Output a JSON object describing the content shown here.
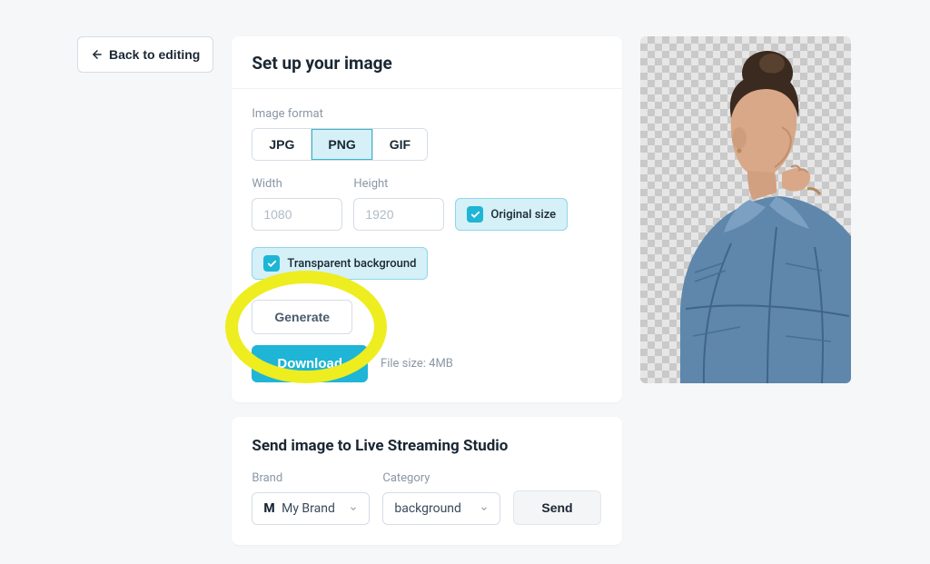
{
  "back_label": "Back to editing",
  "setup": {
    "title": "Set up your image",
    "format_label": "Image format",
    "formats": [
      "JPG",
      "PNG",
      "GIF"
    ],
    "selected_format": "PNG",
    "width_label": "Width",
    "width_value": "1080",
    "height_label": "Height",
    "height_value": "1920",
    "original_size_label": "Original size",
    "transparent_label": "Transparent background",
    "generate_label": "Generate",
    "download_label": "Download",
    "file_size_label": "File size: 4MB"
  },
  "send": {
    "title": "Send image to Live Streaming Studio",
    "brand_label": "Brand",
    "brand_value": "My Brand",
    "brand_mono": "M",
    "category_label": "Category",
    "category_value": "background",
    "send_label": "Send"
  }
}
